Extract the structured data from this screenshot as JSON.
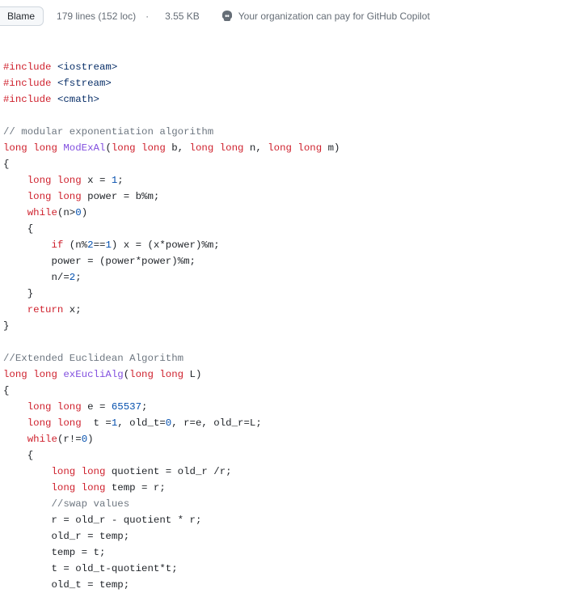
{
  "toolbar": {
    "blame_label": "Blame",
    "lines_text": "179 lines (152 loc)",
    "size_text": "3.55 KB",
    "copilot_text": "Your organization can pay for GitHub Copilot"
  },
  "code": {
    "include1_kw": "#include",
    "include1_hdr": "<iostream>",
    "include2_kw": "#include",
    "include2_hdr": "<fstream>",
    "include3_kw": "#include",
    "include3_hdr": "<cmath>",
    "blank1": "",
    "comment_modexp": "// modular exponentiation algorithm",
    "sig1_type_a": "long",
    "sig1_type_b": "long",
    "sig1_fn": "ModExAl",
    "sig1_open": "(",
    "sig1_p1t": "long long",
    "sig1_p1n": " b, ",
    "sig1_p2t": "long long",
    "sig1_p2n": " n, ",
    "sig1_p3t": "long long",
    "sig1_p3n": " m)",
    "brace_open": "{",
    "mex_l1_t": "long long",
    "mex_l1_rest": " x = ",
    "mex_l1_num": "1",
    "mex_l1_end": ";",
    "mex_l2_t": "long long",
    "mex_l2_rest": " power = b%m;",
    "mex_while_kw": "while",
    "mex_while_cond": "(n>",
    "mex_while_num": "0",
    "mex_while_close": ")",
    "mex_inner_open": "{",
    "mex_if_kw": "if",
    "mex_if_cond": " (n%",
    "mex_if_n2": "2",
    "mex_if_eq": "==",
    "mex_if_n1": "1",
    "mex_if_rest": ") x = (x*power)%m;",
    "mex_pw": "        power = (power*power)%m;",
    "mex_ndiv": "        n/=",
    "mex_ndiv_num": "2",
    "mex_ndiv_end": ";",
    "mex_inner_close": "}",
    "mex_ret_kw": "return",
    "mex_ret_rest": " x;",
    "brace_close": "}",
    "blank2": "",
    "comment_eucl": "//Extended Euclidean Algorithm",
    "sig2_type_a": "long",
    "sig2_type_b": "long",
    "sig2_fn": "exEucliAlg",
    "sig2_open": "(",
    "sig2_p1t": "long long",
    "sig2_p1n": " L)",
    "eu_l1_t": "long long",
    "eu_l1_rest": " e = ",
    "eu_l1_num": "65537",
    "eu_l1_end": ";",
    "eu_l2_t": "long long",
    "eu_l2_rest": "  t =",
    "eu_l2_n1": "1",
    "eu_l2_mid": ", old_t=",
    "eu_l2_n0": "0",
    "eu_l2_end": ", r=e, old_r=L;",
    "eu_while_kw": "while",
    "eu_while_cond": "(r!=",
    "eu_while_num": "0",
    "eu_while_close": ")",
    "eu_inner_open": "{",
    "eu_q_t": "long long",
    "eu_q_rest": " quotient = old_r /r;",
    "eu_tmp_t": "long long",
    "eu_tmp_rest": " temp = r;",
    "eu_swap_c": "//swap values",
    "eu_r": "        r = old_r - quotient * r;",
    "eu_oldr": "        old_r = temp;",
    "eu_tempt": "        temp = t;",
    "eu_t": "        t = old_t-quotient*t;",
    "eu_oldt": "        old_t = temp;"
  }
}
